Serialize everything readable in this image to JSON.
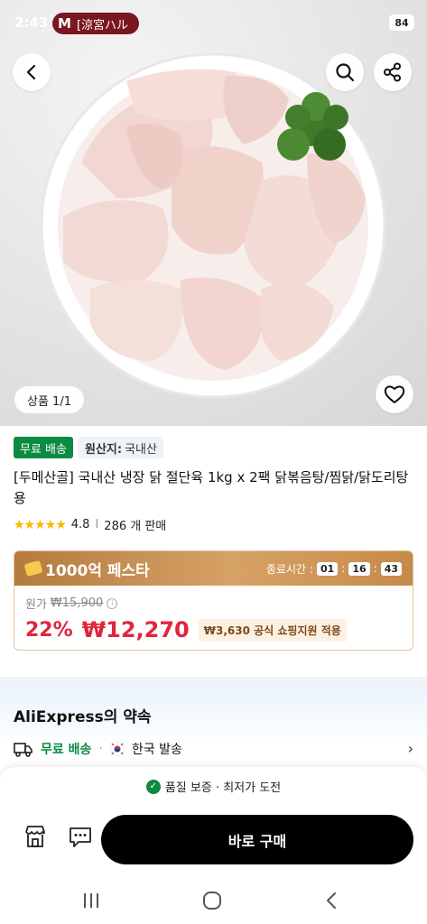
{
  "status_bar": {
    "time": "2:43",
    "app_name": "[涼宮ハル",
    "battery": "84"
  },
  "gallery": {
    "counter": "상품 1/1"
  },
  "badges": {
    "free_shipping": "무료 배송",
    "origin_label": "원산지:",
    "origin_value": "국내산"
  },
  "product": {
    "title": "[두메산골] 국내산 냉장 닭 절단육 1kg x 2팩 닭볶음탕/찜닭/닭도리탕용",
    "stars": "★★★★★",
    "rating": "4.8",
    "separator": "I",
    "sold": "286 개 판매"
  },
  "promo": {
    "title": "1000억 페스타",
    "end_time_label": "종료시간 :",
    "hours": "01",
    "minutes": "16",
    "seconds": "43",
    "original_label": "원가",
    "original_price": "₩15,900",
    "discount": "22%",
    "price": "₩12,270",
    "subsidy": "₩3,630 공식 쇼핑지원 적용"
  },
  "promise": {
    "title": "AliExpress의 약속",
    "free_shipping": "무료 배송",
    "dot": "·",
    "ship_from": "한국 발송"
  },
  "bottom_bar": {
    "guarantee": "품질 보증 · 최저가 도전",
    "buy_label": "바로 구매"
  },
  "colors": {
    "accent_green": "#0b8a42",
    "price_red": "#e0263c",
    "promo_gold": "#c68a4a"
  }
}
